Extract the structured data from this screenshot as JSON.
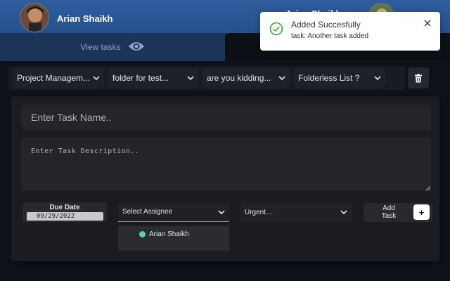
{
  "header": {
    "user_name": "Arian Shaikh",
    "user_name_right": "Arian Shaikh"
  },
  "tabs": {
    "view_tasks": "View tasks"
  },
  "filters": {
    "project": "Project Managem...",
    "folder": "folder for test...",
    "list": "are you kidding...",
    "folderless": "Folderless List ?"
  },
  "form": {
    "task_name_placeholder": "Enter Task Name..",
    "task_desc_placeholder": "Enter Task Description..",
    "due_date_label": "Due Date",
    "due_date_value": "09/29/2022",
    "assignee_placeholder": "Select Assignee",
    "assignee_option": "Arian Shaikh",
    "priority_value": "Urgent...",
    "add_task_label": "Add Task",
    "add_task_plus": "+"
  },
  "toast": {
    "title": "Added Succesfully",
    "message": "task: Another task added"
  },
  "colors": {
    "header_blue": "#2f5d9e",
    "success_green": "#4caf50",
    "assignee_dot": "#5ed3a8"
  },
  "icons": {
    "view_tasks": "eye-icon",
    "delete": "trash-icon",
    "toast_status": "check-circle-icon",
    "toast_close": "close-icon",
    "dropdown": "chevron-down-icon"
  }
}
